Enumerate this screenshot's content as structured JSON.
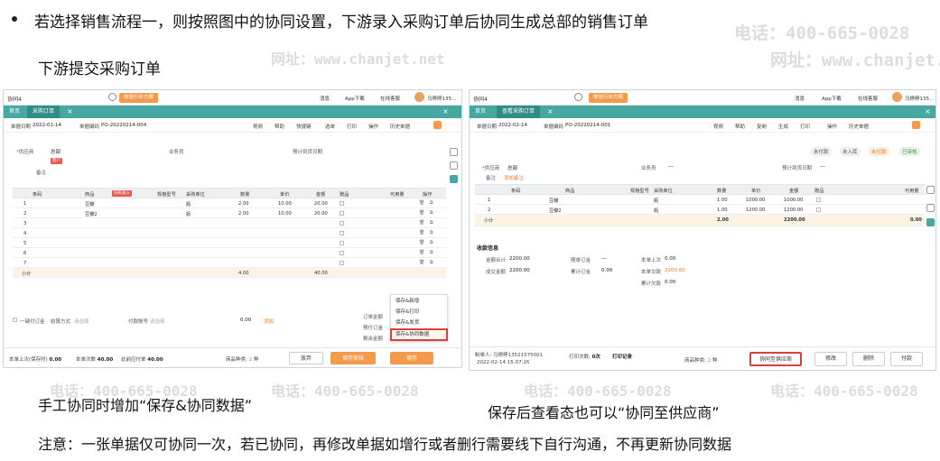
{
  "slide": {
    "bullet": "若选择销售流程一，则按照图中的协同设置，下游录入采购订单后协同生成总部的销售订单",
    "subtitle": "下游提交采购订单",
    "caption_left": "手工协同时增加“保存&协同数据”",
    "caption_right": "保存后查看态也可以“协同至供应商”",
    "note": "注意：一张单据仅可协同一次，若已协同，再修改单据如增行或者删行需要线下自行沟通，不再更新协同数据"
  },
  "watermark": {
    "phone": "电话：400-665-0028",
    "site": "网址：www.chanjet.net"
  },
  "left_shot": {
    "company": "协同4",
    "switch_label": "体验行业方案",
    "top_links": [
      "消息",
      "App下载",
      "在线客服",
      "马婷婷135..."
    ],
    "tabs": {
      "home": "首页",
      "current": "采购订单"
    },
    "meta": {
      "date_label": "单据日期",
      "date": "2022-02-14",
      "code_label": "单据编码",
      "code": "PO-20220214-004"
    },
    "tools": [
      "视频",
      "帮助",
      "快捷键",
      "选单",
      "打印",
      "操作",
      "历史单据"
    ],
    "fields": {
      "vendor_label": "供应商",
      "vendor": "总部",
      "vendor_tag": "客户",
      "clerk_label": "业务员",
      "arrival_label": "预计到货日期",
      "memo_label": "备注"
    },
    "columns": [
      "条码",
      "商品",
      "规格型号",
      "采购单位",
      "数量",
      "单价",
      "金额",
      "赠品",
      "可用量",
      "操作"
    ],
    "scan_tag": "扫码录入",
    "rows": [
      {
        "no": "1",
        "product": "豆瓣",
        "unit": "瓶",
        "qty": "2.00",
        "price": "10.00",
        "amount": "20.00"
      },
      {
        "no": "2",
        "product": "豆瓣2",
        "unit": "瓶",
        "qty": "2.00",
        "price": "10.00",
        "amount": "20.00"
      },
      {
        "no": "3"
      },
      {
        "no": "4"
      },
      {
        "no": "5"
      },
      {
        "no": "6"
      },
      {
        "no": "7"
      }
    ],
    "subtotal": {
      "label": "小计",
      "qty": "4.00",
      "amount": "40.00"
    },
    "footer_fields": {
      "onekey": "一键付订金",
      "settle_label": "结算方式",
      "settle_ph": "请选择",
      "account_label": "付款账号",
      "account_ph": "请选择",
      "amount": "0.00",
      "add": "添加"
    },
    "summary_labels": [
      "订单金额",
      "预付订金",
      "剩余金额"
    ],
    "dropdown": [
      "保存&新增",
      "保存&打印",
      "保存&发货",
      "保存&协同数据"
    ],
    "bottom": {
      "qty_label": "本单上次(保存时)",
      "qty_val": "0.00",
      "pieces_label": "本单次数",
      "pieces_val": "40.00",
      "last_label": "此前应付单",
      "last_val": "40.00",
      "kinds_label": "商品种类:",
      "kinds_val": "2",
      "kinds_unit": "种",
      "btn_discard": "放弃",
      "btn_save_review": "保存审核",
      "btn_save": "保存"
    }
  },
  "right_shot": {
    "company": "协同4",
    "switch_label": "体验行业方案",
    "top_links": [
      "消息",
      "App下载",
      "在线客服",
      "马婷婷135..."
    ],
    "tabs": {
      "home": "首页",
      "current": "查看采购订单"
    },
    "meta": {
      "date_label": "单据日期",
      "date": "2022-02-14",
      "code_label": "单据编码",
      "code": "PO-20220214-001"
    },
    "tools": [
      "视频",
      "帮助",
      "复制",
      "生成",
      "打印",
      "操作",
      "历史单据"
    ],
    "status_chips": [
      "未付款",
      "未入库",
      "未付款",
      "已审核"
    ],
    "fields": {
      "vendor_label": "供应商",
      "vendor": "总部",
      "clerk_label": "业务员",
      "clerk": "---",
      "arrival_label": "预计到货日期",
      "arrival": "---",
      "memo_label": "备注",
      "memo_link": "添加备注"
    },
    "columns": [
      "条码",
      "商品",
      "规格型号",
      "采购单位",
      "数量",
      "单价",
      "金额",
      "赠品",
      "可用量"
    ],
    "rows": [
      {
        "no": "1",
        "product": "豆瓣",
        "unit": "瓶",
        "qty": "1.00",
        "price": "1000.00",
        "amount": "1000.00"
      },
      {
        "no": "2",
        "product": "豆瓣2",
        "unit": "瓶",
        "qty": "1.00",
        "price": "1200.00",
        "amount": "1200.00"
      }
    ],
    "subtotal": {
      "label": "小计",
      "qty": "2.00",
      "amount": "2200.00",
      "avail": "0.00"
    },
    "receipt": {
      "title": "收款信息",
      "total_label": "金额合计",
      "total": "2200.00",
      "deposit_label": "随单订金",
      "deposit": "---",
      "paid_label": "本单上次",
      "paid": "0.00",
      "deal_label": "成交金额",
      "deal": "2200.00",
      "acc_deposit_label": "累计订金",
      "acc_deposit": "0.00",
      "this_label": "本单欠款",
      "this": "2200.00",
      "acc_label": "累计欠款",
      "acc": "0.00"
    },
    "bottom": {
      "maker_label": "制单人:",
      "maker": "马婷婷13521575001",
      "time": "2022-02-14 15:07:26",
      "print_label": "打印次数:",
      "print": "0次",
      "print_log": "打印记录",
      "kinds_label": "商品种类:",
      "kinds_val": "2",
      "kinds_unit": "种",
      "btn_sync": "协同至供应商",
      "btn_edit": "修改",
      "btn_delete": "删除",
      "btn_pay": "付款"
    }
  },
  "colors": {
    "teal": "#47a7a1",
    "orange": "#f39a4c",
    "highlight": "#d9413a"
  }
}
